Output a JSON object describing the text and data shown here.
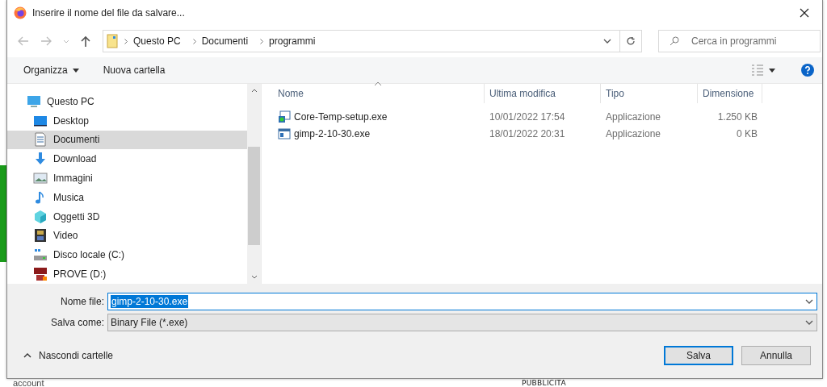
{
  "background": {
    "texts": [
      {
        "kind": "body",
        "text": "account"
      },
      {
        "kind": "caption",
        "text": "PUBBLICITA"
      }
    ]
  },
  "window": {
    "title": "Inserire il nome del file da salvare..."
  },
  "address": {
    "path": [
      "Questo PC",
      "Documenti",
      "programmi"
    ]
  },
  "search": {
    "placeholder": "Cerca in programmi"
  },
  "toolbar": {
    "organize": "Organizza",
    "new_folder": "Nuova cartella"
  },
  "sidebar": {
    "items": [
      {
        "label": "Questo PC",
        "selected": false,
        "children": [
          {
            "label": "Desktop",
            "selected": false
          },
          {
            "label": "Documenti",
            "selected": true
          },
          {
            "label": "Download",
            "selected": false
          },
          {
            "label": "Immagini",
            "selected": false
          },
          {
            "label": "Musica",
            "selected": false
          },
          {
            "label": "Oggetti 3D",
            "selected": false
          },
          {
            "label": "Video",
            "selected": false
          },
          {
            "label": "Disco locale (C:)",
            "selected": false
          },
          {
            "label": "PROVE (D:)",
            "selected": false
          }
        ]
      }
    ]
  },
  "table": {
    "columns": [
      "Nome",
      "Ultima modifica",
      "Tipo",
      "Dimensione"
    ],
    "rows": [
      {
        "cells": [
          "Core-Temp-setup.exe",
          "10/01/2022 17:54",
          "Applicazione",
          "1.250 KB"
        ]
      },
      {
        "cells": [
          "gimp-2-10-30.exe",
          "18/01/2022 20:31",
          "Applicazione",
          "0 KB"
        ]
      }
    ]
  },
  "filename": {
    "label": "Nome file:",
    "value": "gimp-2-10-30.exe"
  },
  "filetype": {
    "label": "Salva come:",
    "value": "Binary File (*.exe)"
  },
  "hide_folders": "Nascondi cartelle",
  "buttons": [
    {
      "label": "Salva",
      "default": true
    },
    {
      "label": "Annulla",
      "default": false
    }
  ]
}
